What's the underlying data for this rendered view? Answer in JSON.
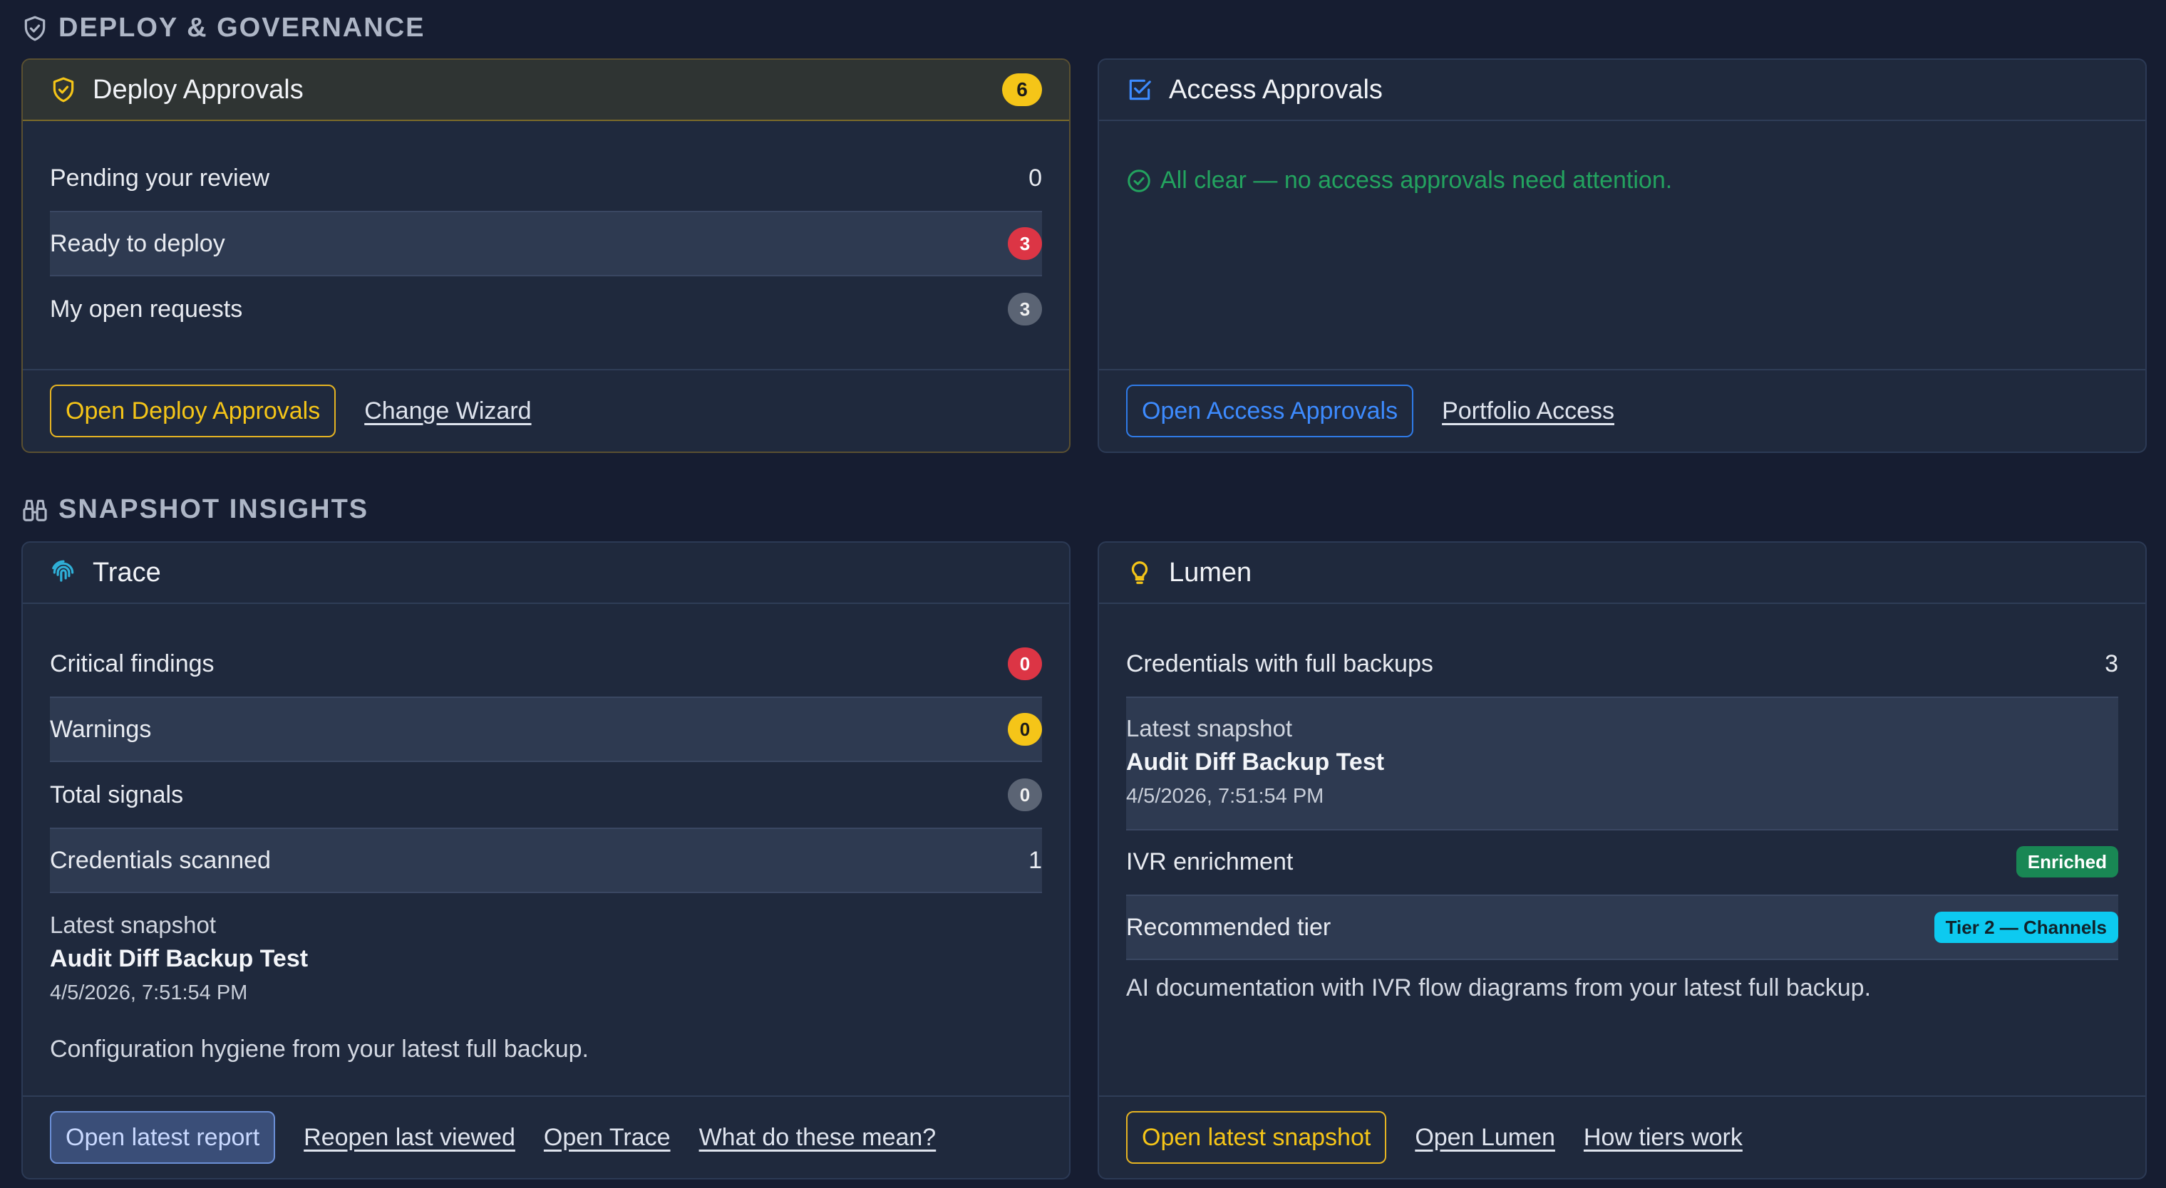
{
  "deploy_section": {
    "title": "DEPLOY & GOVERNANCE",
    "deploy_card": {
      "title": "Deploy Approvals",
      "count": "6",
      "rows": [
        {
          "label": "Pending your review",
          "value": "0"
        },
        {
          "label": "Ready to deploy",
          "value": "3"
        },
        {
          "label": "My open requests",
          "value": "3"
        }
      ],
      "primary_button": "Open Deploy Approvals",
      "link": "Change Wizard"
    },
    "access_card": {
      "title": "Access Approvals",
      "message": "All clear — no access approvals need attention.",
      "primary_button": "Open Access Approvals",
      "link": "Portfolio Access"
    }
  },
  "insights_section": {
    "title": "SNAPSHOT INSIGHTS",
    "trace_card": {
      "title": "Trace",
      "rows": [
        {
          "label": "Critical findings",
          "value": "0"
        },
        {
          "label": "Warnings",
          "value": "0"
        },
        {
          "label": "Total signals",
          "value": "0"
        },
        {
          "label": "Credentials scanned",
          "value": "1"
        }
      ],
      "snapshot": {
        "label": "Latest snapshot",
        "name": "Audit Diff Backup Test",
        "date": "4/5/2026, 7:51:54 PM"
      },
      "description": "Configuration hygiene from your latest full backup.",
      "primary_button": "Open latest report",
      "links": [
        "Reopen last viewed",
        "Open Trace",
        "What do these mean?"
      ]
    },
    "lumen_card": {
      "title": "Lumen",
      "credentials_row": {
        "label": "Credentials with full backups",
        "value": "3"
      },
      "snapshot": {
        "label": "Latest snapshot",
        "name": "Audit Diff Backup Test",
        "date": "4/5/2026, 7:51:54 PM"
      },
      "ivr_row": {
        "label": "IVR enrichment",
        "badge": "Enriched"
      },
      "tier_row": {
        "label": "Recommended tier",
        "badge": "Tier 2 — Channels"
      },
      "description": "AI documentation with IVR flow diagrams from your latest full backup.",
      "primary_button": "Open latest snapshot",
      "links": [
        "Open Lumen",
        "How tiers work"
      ]
    }
  },
  "colors": {
    "background": "#161d31",
    "card": "#1f293d",
    "accent_yellow": "#f5c518",
    "accent_blue": "#3d8bff",
    "danger": "#dc3545",
    "success": "#198754",
    "info": "#0dcaf0"
  },
  "icons": {
    "deploy_section": "shield-check-icon",
    "deploy_card": "shield-check-icon",
    "access_card": "checkbox-icon",
    "access_message": "check-circle-icon",
    "insights_section": "binoculars-icon",
    "trace_card": "fingerprint-icon",
    "lumen_card": "lightbulb-icon"
  }
}
